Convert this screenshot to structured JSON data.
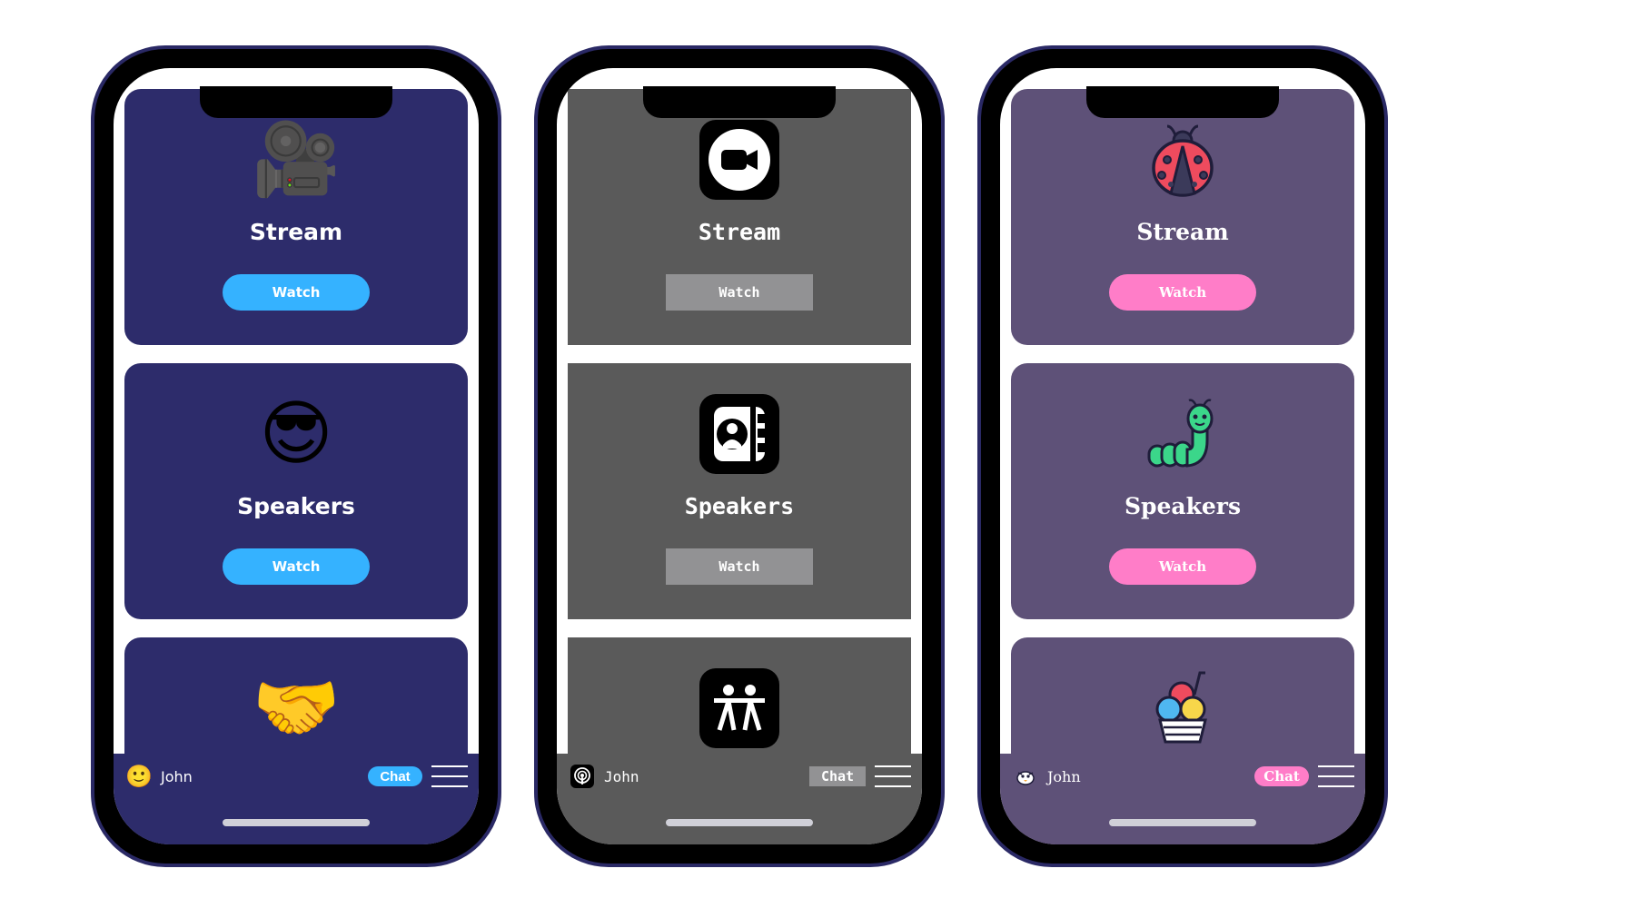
{
  "phones": [
    {
      "theme": "navy",
      "colors": {
        "background": "#2d2c6b",
        "accent": "#35b2ff"
      },
      "cards": [
        {
          "title": "Stream",
          "button": "Watch",
          "icon": "movie-camera-icon",
          "glyph": "🎥"
        },
        {
          "title": "Speakers",
          "button": "Watch",
          "icon": "cool-face-icon",
          "glyph": "😎"
        },
        {
          "title": "",
          "button": "",
          "icon": "handshake-icon",
          "glyph": "🤝"
        }
      ],
      "bottom_bar": {
        "avatar_icon": "smiley-icon",
        "avatar_glyph": "🙂",
        "user": "John",
        "chat": "Chat",
        "menu_icon": "menu-icon"
      }
    },
    {
      "theme": "gray",
      "colors": {
        "background": "#5a5a5a",
        "accent": "#929294"
      },
      "cards": [
        {
          "title": "Stream",
          "button": "Watch",
          "icon": "video-camera-icon"
        },
        {
          "title": "Speakers",
          "button": "Watch",
          "icon": "contacts-book-icon"
        },
        {
          "title": "",
          "button": "",
          "icon": "people-icon"
        }
      ],
      "bottom_bar": {
        "avatar_icon": "podcast-icon",
        "user": "John",
        "chat": "Chat",
        "menu_icon": "menu-icon"
      }
    },
    {
      "theme": "purple",
      "colors": {
        "background": "#5e5178",
        "accent": "#ff7dc8"
      },
      "cards": [
        {
          "title": "Stream",
          "button": "Watch",
          "icon": "ladybug-icon"
        },
        {
          "title": "Speakers",
          "button": "Watch",
          "icon": "caterpillar-icon"
        },
        {
          "title": "",
          "button": "",
          "icon": "ice-cream-icon"
        }
      ],
      "bottom_bar": {
        "avatar_icon": "bird-icon",
        "user": "John",
        "chat": "Chat",
        "menu_icon": "menu-icon"
      }
    }
  ]
}
